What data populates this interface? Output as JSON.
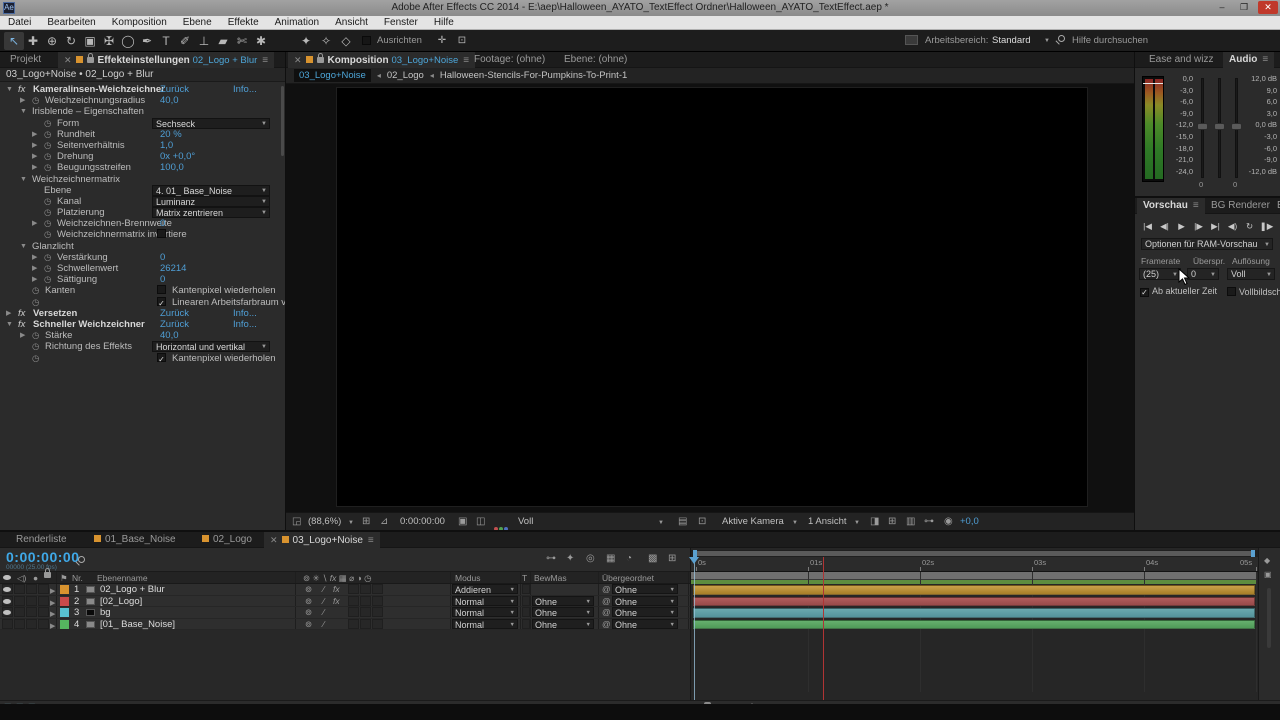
{
  "titlebar": {
    "app_icon": "Ae",
    "title": "Adobe After Effects CC 2014 - E:\\aep\\Halloween_AYATO_TextEffect Ordner\\Halloween_AYATO_TextEffect.aep *",
    "minimize": "–",
    "maximize": "❐",
    "close": "✕"
  },
  "menubar": {
    "items": [
      "Datei",
      "Bearbeiten",
      "Komposition",
      "Ebene",
      "Effekte",
      "Animation",
      "Ansicht",
      "Fenster",
      "Hilfe"
    ]
  },
  "toolbar": {
    "tools": [
      "selection-tool",
      "hand-tool",
      "zoom-tool",
      "rotation-tool",
      "camera-tool",
      "pan-behind-tool",
      "shape-tool",
      "pen-tool",
      "text-tool",
      "brush-tool",
      "clone-stamp-tool",
      "eraser-tool",
      "roto-brush-tool",
      "puppet-pin-tool"
    ],
    "axis_tools": [
      "local-axis-mode",
      "world-axis-mode",
      "view-axis-mode"
    ],
    "align_label": "Ausrichten",
    "workspace_label": "Arbeitsbereich:",
    "workspace_value": "Standard",
    "search_placeholder": "Hilfe durchsuchen"
  },
  "effects_panel": {
    "tab_project": "Projekt",
    "tab_title": "Effekteinstellungen",
    "tab_target": "02_Logo + Blur",
    "breadcrumb": "03_Logo+Noise • 02_Logo + Blur",
    "reset_label": "Zurück",
    "info_label": "Info...",
    "rows": [
      {
        "i": 0,
        "tw": "▼",
        "icon": "fx",
        "label": "Kameralinsen-Weichzeichner",
        "type": "effect"
      },
      {
        "i": 1,
        "tw": "▶",
        "sw": 1,
        "label": "Weichzeichnungsradius",
        "type": "val",
        "value": "40,0"
      },
      {
        "i": 1,
        "tw": "▼",
        "label": "Irisblende – Eigenschaften",
        "type": "group"
      },
      {
        "i": 2,
        "sw": 1,
        "label": "Form",
        "type": "dd",
        "value": "Sechseck"
      },
      {
        "i": 2,
        "tw": "▶",
        "sw": 1,
        "label": "Rundheit",
        "type": "val",
        "value": "20 %"
      },
      {
        "i": 2,
        "tw": "▶",
        "sw": 1,
        "label": "Seitenverhältnis",
        "type": "val",
        "value": "1,0"
      },
      {
        "i": 2,
        "tw": "▶",
        "sw": 1,
        "label": "Drehung",
        "type": "val",
        "value": "0x +0,0°"
      },
      {
        "i": 2,
        "tw": "▶",
        "sw": 1,
        "label": "Beugungsstreifen",
        "type": "val",
        "value": "100,0"
      },
      {
        "i": 1,
        "tw": "▼",
        "label": "Weichzeichnermatrix",
        "type": "group"
      },
      {
        "i": 2,
        "label": "Ebene",
        "type": "dd",
        "value": "4. 01_ Base_Noise"
      },
      {
        "i": 2,
        "sw": 1,
        "label": "Kanal",
        "type": "dd",
        "value": "Luminanz"
      },
      {
        "i": 2,
        "sw": 1,
        "label": "Platzierung",
        "type": "dd",
        "value": "Matrix zentrieren"
      },
      {
        "i": 2,
        "tw": "▶",
        "sw": 1,
        "label": "Weichzeichnen-Brennweite",
        "type": "val",
        "value": "0"
      },
      {
        "i": 2,
        "sw": 1,
        "label": "Weichzeichnermatrix invertiere",
        "type": "check",
        "checked": false,
        "checklabel": ""
      },
      {
        "i": 1,
        "tw": "▼",
        "label": "Glanzlicht",
        "type": "group"
      },
      {
        "i": 2,
        "tw": "▶",
        "sw": 1,
        "label": "Verstärkung",
        "type": "val",
        "value": "0"
      },
      {
        "i": 2,
        "tw": "▶",
        "sw": 1,
        "label": "Schwellenwert",
        "type": "val",
        "value": "26214"
      },
      {
        "i": 2,
        "tw": "▶",
        "sw": 1,
        "label": "Sättigung",
        "type": "val",
        "value": "0"
      },
      {
        "i": 1,
        "sw": 1,
        "label": "Kanten",
        "type": "check",
        "checked": false,
        "checklabel": "Kantenpixel wiederholen"
      },
      {
        "i": 1,
        "sw": 1,
        "label": "",
        "type": "check",
        "checked": true,
        "checklabel": "Linearen Arbeitsfarbraum verw"
      },
      {
        "i": 0,
        "tw": "▶",
        "icon": "fx",
        "label": "Versetzen",
        "type": "effect"
      },
      {
        "i": 0,
        "tw": "▼",
        "icon": "fx",
        "label": "Schneller Weichzeichner",
        "type": "effect"
      },
      {
        "i": 1,
        "tw": "▶",
        "sw": 1,
        "label": "Stärke",
        "type": "val",
        "value": "40,0"
      },
      {
        "i": 1,
        "sw": 1,
        "label": "Richtung des Effekts",
        "type": "dd",
        "value": "Horizontal und vertikal"
      },
      {
        "i": 1,
        "sw": 1,
        "label": "",
        "type": "check",
        "checked": true,
        "checklabel": "Kantenpixel wiederholen"
      }
    ]
  },
  "comp_panel": {
    "tab_label": "Komposition",
    "tab_target": "03_Logo+Noise",
    "tab_footage": "Footage: (ohne)",
    "tab_layer": "Ebene: (ohne)",
    "breadcrumb": [
      "03_Logo+Noise",
      "02_Logo",
      "Halloween-Stencils-For-Pumpkins-To-Print-1"
    ],
    "status": {
      "zoom": "(88,6%)",
      "timecode": "0:00:00:00",
      "channels": "Voll",
      "camera": "Aktive Kamera",
      "view": "1 Ansicht",
      "exposure": "+0,0"
    },
    "artwork_color": "#12e04c"
  },
  "audio_panel": {
    "tab_inactive": "Ease and wizz",
    "tab_active": "Audio",
    "left_scale": [
      "0,0",
      "-3,0",
      "-6,0",
      "-9,0",
      "-12,0",
      "-15,0",
      "-18,0",
      "-21,0",
      "-24,0"
    ],
    "right_scale": [
      "12,0 dB",
      "9,0",
      "6,0",
      "3,0",
      "0,0 dB",
      "-3,0",
      "-6,0",
      "-9,0",
      "-12,0 dB"
    ],
    "slider_values": [
      "0",
      "0"
    ]
  },
  "preview_panel": {
    "tab_active": "Vorschau",
    "tab_bg": "BG Renderer",
    "tab_overflow": "E",
    "transport": [
      "go-to-start",
      "previous-frame",
      "play",
      "next-frame",
      "go-to-end",
      "audio-toggle",
      "loop-toggle",
      "ram-preview"
    ],
    "ram_options_label": "Optionen für RAM-Vorschau",
    "framerate_label": "Framerate",
    "skip_label": "Überspr.",
    "resolution_label": "Auflösung",
    "framerate_value": "(25)",
    "skip_value": "0",
    "resolution_value": "Voll",
    "from_current_label": "Ab aktueller Zeit",
    "from_current_checked": true,
    "fullscreen_label": "Vollbildschirm",
    "fullscreen_checked": false
  },
  "timeline": {
    "tabs": [
      {
        "label": "Renderliste",
        "icon": false,
        "active": false
      },
      {
        "label": "01_Base_Noise",
        "icon": true,
        "active": false
      },
      {
        "label": "02_Logo",
        "icon": true,
        "active": false
      },
      {
        "label": "03_Logo+Noise",
        "icon": true,
        "active": true
      }
    ],
    "timecode": "0:00:00:00",
    "timecode_sub": "00000 (25.00 fps)",
    "columns": {
      "nr": "Nr.",
      "name": "Ebenenname",
      "mode": "Modus",
      "t": "T",
      "trkmat": "BewMas",
      "parent": "Übergeordnet"
    },
    "layers": [
      {
        "nr": "1",
        "name": "02_Logo + Blur",
        "label_color": "#d8932f",
        "visible": true,
        "fx": true,
        "mode": "Addieren",
        "trkmat": "",
        "parent": "Ohne",
        "bar_top": "#caa04a",
        "bar": "#a87f28"
      },
      {
        "nr": "2",
        "name": "[02_Logo]",
        "label_color": "#c84a4a",
        "visible": true,
        "fx": true,
        "mode": "Normal",
        "trkmat": "Ohne",
        "parent": "Ohne",
        "bar_top": "#b05c5c",
        "bar": "#984a4a"
      },
      {
        "nr": "3",
        "name": "bg",
        "label_color": "#58c0d0",
        "visible": true,
        "fx": false,
        "mode": "Normal",
        "trkmat": "Ohne",
        "parent": "Ohne",
        "bar_top": "#6aa8ae",
        "bar": "#54939b"
      },
      {
        "nr": "4",
        "name": "[01_ Base_Noise]",
        "label_color": "#55b55f",
        "visible": false,
        "fx": false,
        "mode": "Normal",
        "trkmat": "Ohne",
        "parent": "Ohne",
        "bar_top": "#66b06e",
        "bar": "#4f9a58"
      }
    ],
    "ruler_ticks": [
      "0s",
      "01s",
      "02s",
      "03s",
      "04s",
      "05s"
    ],
    "mode_value_none": "Ohne"
  },
  "colors": {
    "value_blue": "#4f9fd6",
    "timecode_blue": "#3fa9e8",
    "artwork_green": "#12e04c",
    "red_marker": "#b03434"
  }
}
